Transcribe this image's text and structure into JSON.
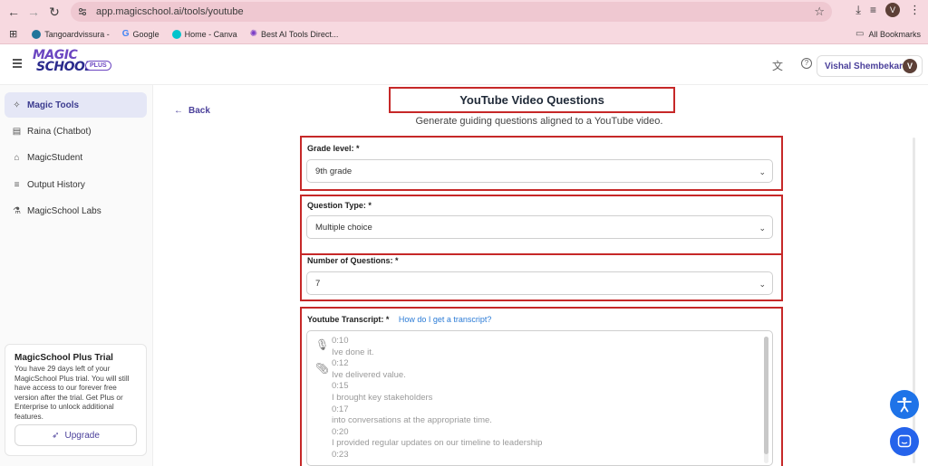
{
  "browser": {
    "url": "app.magicschool.ai/tools/youtube",
    "avatar_letter": "V",
    "bookmarks": [
      {
        "label": "Tangoardvissura -"
      },
      {
        "label": "Google"
      },
      {
        "label": "Home - Canva"
      },
      {
        "label": "Best AI Tools Direct..."
      }
    ],
    "all_bookmarks": "All Bookmarks"
  },
  "app": {
    "logo_top": "MAGIC",
    "logo_bottom": "SCHOOL",
    "logo_badge": "PLUS",
    "user_name": "Vishal Shembekar",
    "user_initial": "V"
  },
  "sidebar": {
    "items": [
      {
        "label": "Magic Tools",
        "icon": "wand-icon",
        "active": true
      },
      {
        "label": "Raina (Chatbot)",
        "icon": "chat-icon",
        "active": false
      },
      {
        "label": "MagicStudent",
        "icon": "graduation-cap-icon",
        "active": false
      },
      {
        "label": "Output History",
        "icon": "history-list-icon",
        "active": false
      },
      {
        "label": "MagicSchool Labs",
        "icon": "flask-icon",
        "active": false
      }
    ],
    "trial": {
      "title": "MagicSchool Plus Trial",
      "body": "You have 29 days left of your MagicSchool Plus trial. You will still have access to our forever free version after the trial. Get Plus or Enterprise to unlock additional features.",
      "button": "Upgrade"
    }
  },
  "main": {
    "back": "Back",
    "title": "YouTube Video Questions",
    "subtitle": "Generate guiding questions aligned to a YouTube video.",
    "grade_level": {
      "label": "Grade level: *",
      "value": "9th grade"
    },
    "question_type": {
      "label": "Question Type: *",
      "value": "Multiple choice"
    },
    "num_questions": {
      "label": "Number of Questions: *",
      "value": "7"
    },
    "transcript": {
      "label": "Youtube Transcript: *",
      "help": "How do I get a transcript?",
      "lines": [
        "0:10",
        "Ive done it.",
        "0:12",
        "Ive delivered value.",
        "0:15",
        "I brought key stakeholders",
        "0:17",
        "into conversations at the appropriate time.",
        "0:20",
        "I provided regular updates on our timeline to leadership",
        "0:23"
      ]
    }
  },
  "colors": {
    "accent": "#4a3f9a",
    "highlight_border": "#c62828",
    "accessibility_fab": "#1e73e8",
    "chat_fab": "#2563eb"
  }
}
